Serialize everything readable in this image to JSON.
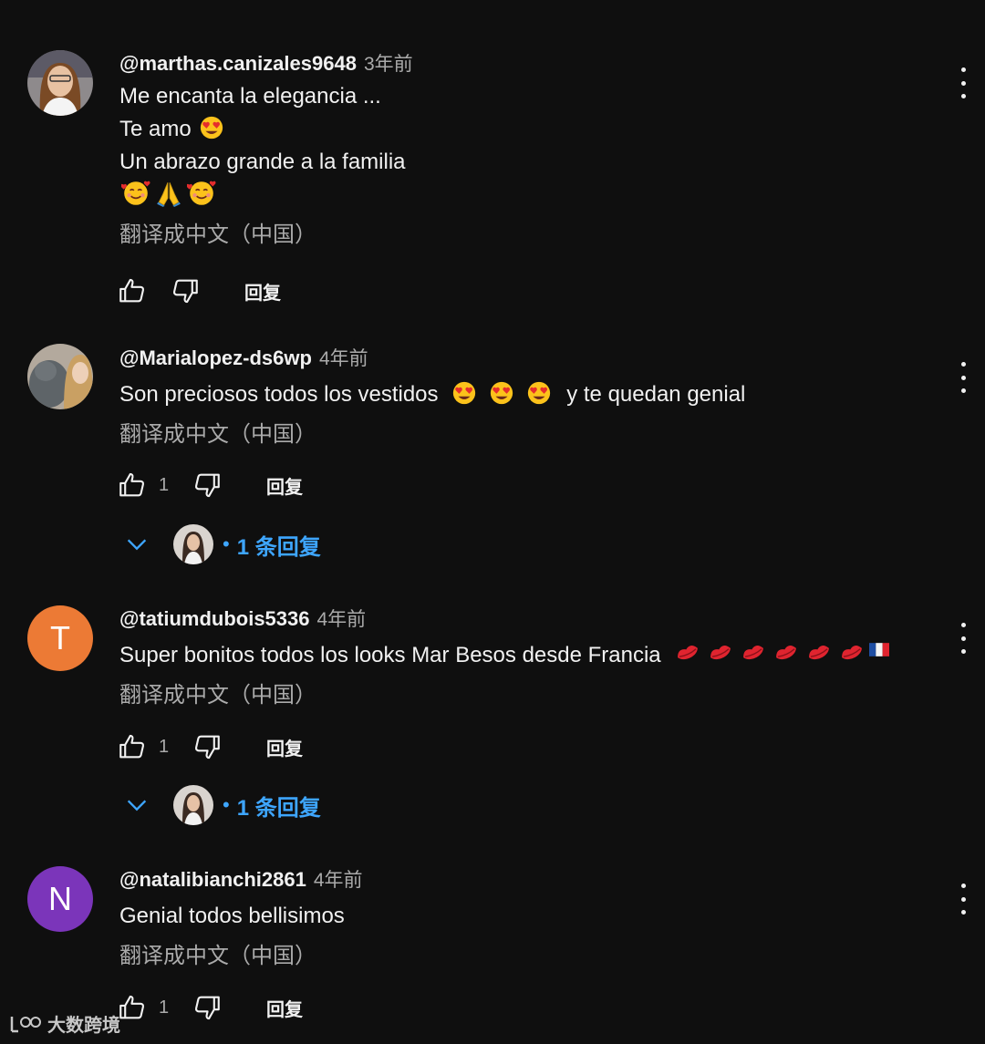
{
  "comments": [
    {
      "handle": "@marthas.canizales9648",
      "time": "3年前",
      "lines": [
        "Me encanta la elegancia ...",
        "Te amo",
        "Un abrazo grande a la familia"
      ],
      "translate": "翻译成中文（中国）",
      "likes": "",
      "reply_label": "回复"
    },
    {
      "handle": "@Marialopez-ds6wp",
      "time": "4年前",
      "text": "Son preciosos todos los vestidos",
      "text_suffix": "y te quedan genial",
      "translate": "翻译成中文（中国）",
      "likes": "1",
      "reply_label": "回复",
      "replies_label": "1 条回复"
    },
    {
      "handle": "@tatiumdubois5336",
      "time": "4年前",
      "avatar_letter": "T",
      "avatar_color": "#ec7a35",
      "text": "Super bonitos todos los looks Mar Besos desde Francia",
      "translate": "翻译成中文（中国）",
      "likes": "1",
      "reply_label": "回复",
      "replies_label": "1 条回复"
    },
    {
      "handle": "@natalibianchi2861",
      "time": "4年前",
      "avatar_letter": "N",
      "avatar_color": "#7b35ba",
      "text": "Genial todos bellisimos",
      "translate": "翻译成中文（中国）",
      "likes": "1",
      "reply_label": "回复"
    }
  ],
  "icons": {
    "like": "thumbs-up-icon",
    "dislike": "thumbs-down-icon",
    "more": "more-vert-icon",
    "expand": "chevron-down-icon"
  },
  "colors": {
    "background": "#0f0f0f",
    "link": "#3ea6ff",
    "secondary": "#aaaaaa"
  },
  "watermark": {
    "text": "大数跨境"
  }
}
